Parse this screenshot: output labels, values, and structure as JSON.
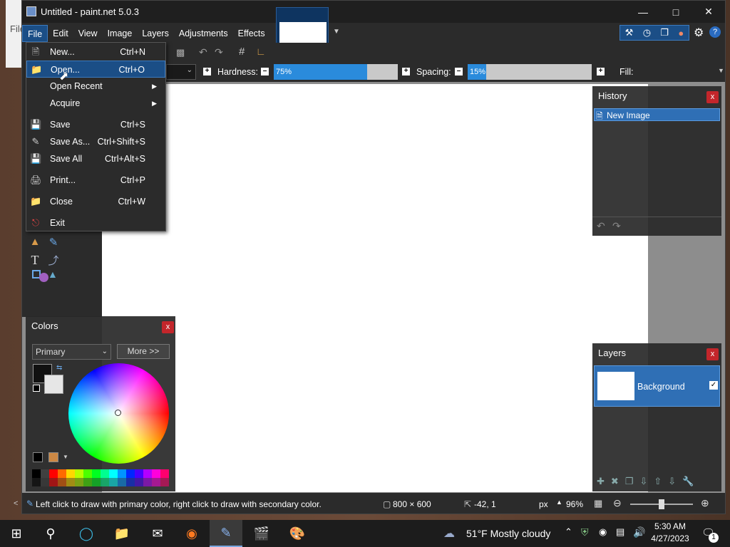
{
  "window": {
    "title": "Untitled - paint.net 5.0.3"
  },
  "background_app": {
    "menu_fragment": "File"
  },
  "menubar": {
    "items": [
      "File",
      "Edit",
      "View",
      "Image",
      "Layers",
      "Adjustments",
      "Effects"
    ]
  },
  "toolbar": {
    "hardness_label": "Hardness:",
    "hardness_value": "75%",
    "hardness_pct": 75,
    "spacing_label": "Spacing:",
    "spacing_value": "15%",
    "spacing_pct": 15,
    "fill_label": "Fill:"
  },
  "file_menu": {
    "items": [
      {
        "label": "New...",
        "shortcut": "Ctrl+N",
        "icon": "new-file-icon"
      },
      {
        "label": "Open...",
        "shortcut": "Ctrl+O",
        "icon": "open-folder-icon",
        "highlighted": true
      },
      {
        "label": "Open Recent",
        "submenu": true
      },
      {
        "label": "Acquire",
        "submenu": true
      },
      {
        "label": "Save",
        "shortcut": "Ctrl+S",
        "icon": "save-icon"
      },
      {
        "label": "Save As...",
        "shortcut": "Ctrl+Shift+S",
        "icon": "save-as-icon"
      },
      {
        "label": "Save All",
        "shortcut": "Ctrl+Alt+S",
        "icon": "save-all-icon"
      },
      {
        "label": "Print...",
        "shortcut": "Ctrl+P",
        "icon": "print-icon"
      },
      {
        "label": "Close",
        "shortcut": "Ctrl+W",
        "icon": "close-file-icon"
      },
      {
        "label": "Exit",
        "icon": "exit-icon"
      }
    ]
  },
  "history_panel": {
    "title": "History",
    "items": [
      "New Image"
    ]
  },
  "layers_panel": {
    "title": "Layers",
    "layers": [
      {
        "name": "Background",
        "visible": true
      }
    ]
  },
  "colors_panel": {
    "title": "Colors",
    "mode": "Primary",
    "more_button": "More >>",
    "primary_color": "#111111",
    "secondary_color": "#e6e6e6"
  },
  "palette": [
    "#000000",
    "#404040",
    "#ff0000",
    "#ff6a00",
    "#ffd800",
    "#b6ff00",
    "#4cff00",
    "#00ff21",
    "#00ff90",
    "#00ffff",
    "#0094ff",
    "#0026ff",
    "#4800ff",
    "#b200ff",
    "#ff00dc",
    "#ff006e"
  ],
  "status": {
    "hint": "Left click to draw with primary color, right click to draw with secondary color.",
    "image_size": "800 × 600",
    "cursor_pos": "-42, 1",
    "unit": "px",
    "zoom": "96%"
  },
  "taskbar": {
    "weather": "51°F  Mostly cloudy",
    "time": "5:30 AM",
    "date": "4/27/2023",
    "notification_count": "1"
  }
}
